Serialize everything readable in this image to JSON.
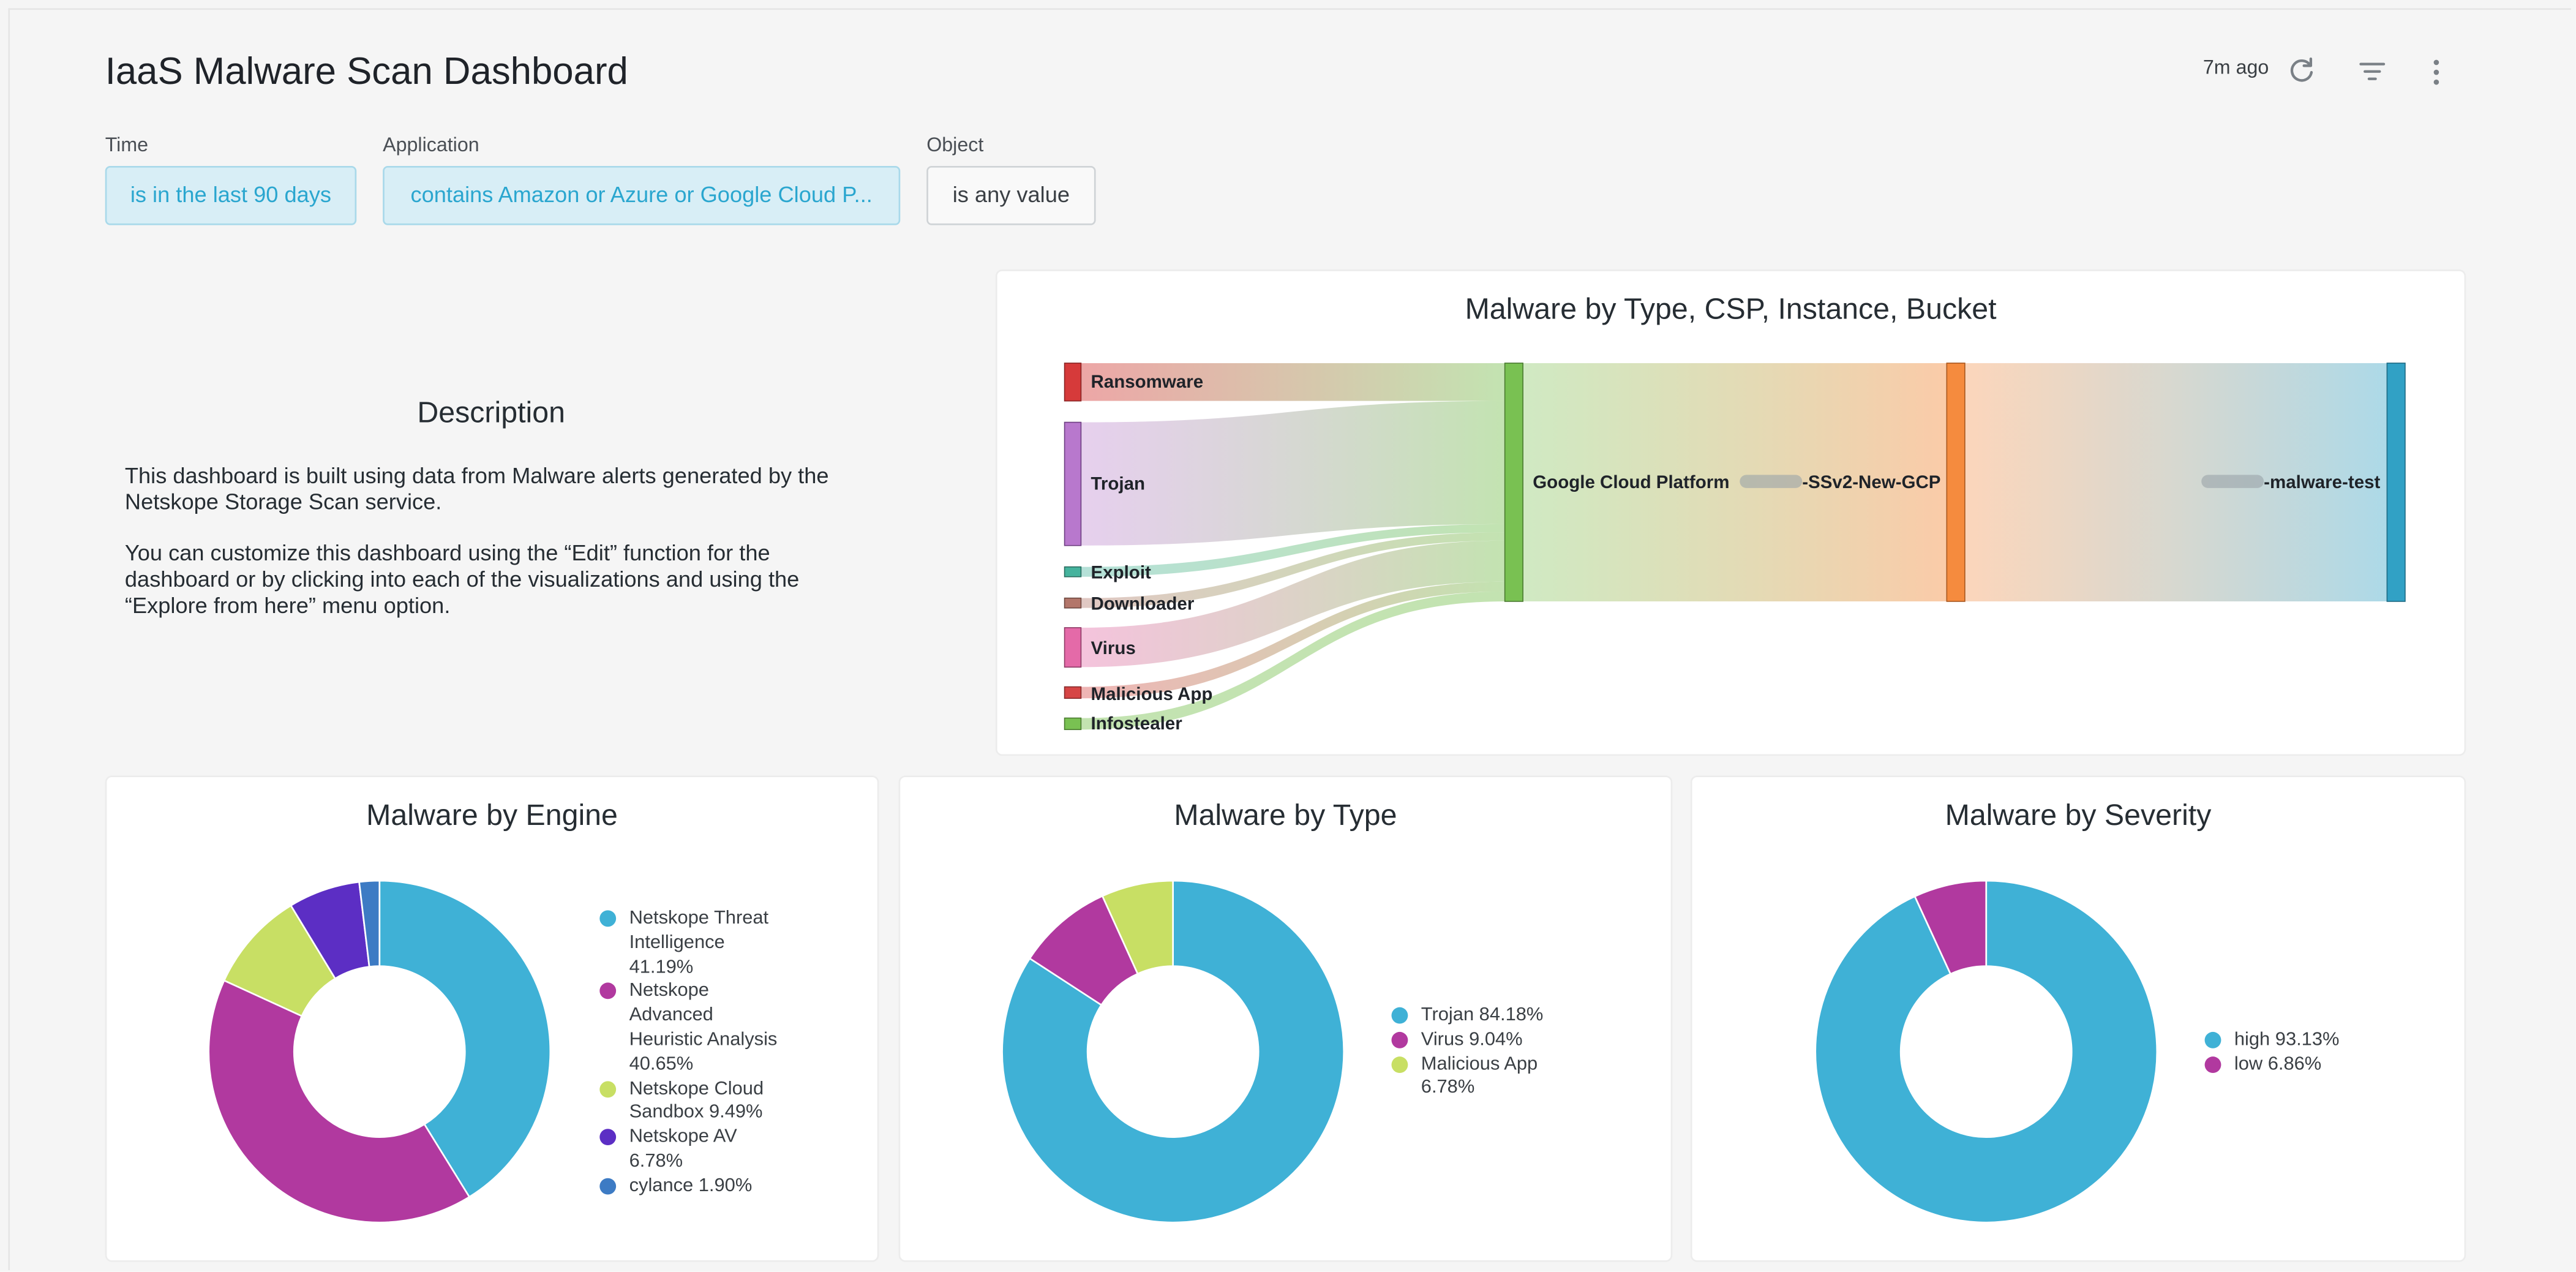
{
  "header": {
    "title": "IaaS Malware Scan Dashboard",
    "last_updated": "7m ago"
  },
  "filters": [
    {
      "label": "Time",
      "value": "is in the last 90 days"
    },
    {
      "label": "Application",
      "value": "contains Amazon or Azure or Google Cloud P..."
    },
    {
      "label": "Object",
      "value": "is any value"
    }
  ],
  "description": {
    "title": "Description",
    "paragraph1": "This dashboard is built using data from Malware alerts generated by the Netskope Storage Scan service.",
    "paragraph2": "You can customize this dashboard using the “Edit” function for the dashboard or by clicking into each of the visualizations and using the “Explore from here” menu option."
  },
  "colors": {
    "blue": "#3fb1d6",
    "magenta": "#b1399f",
    "lime": "#c8df64",
    "purple": "#5c2ec4",
    "steel": "#3d7bc4",
    "sankey_green": "#79c152",
    "sankey_orange": "#f58b3e",
    "sankey_teal": "#31a1c5"
  },
  "sankey": {
    "title": "Malware by Type, CSP, Instance, Bucket",
    "sources": [
      {
        "label": "Ransomware",
        "color": "#d63a3a"
      },
      {
        "label": "Trojan",
        "color": "#b878cd"
      },
      {
        "label": "Exploit",
        "color": "#45b39d"
      },
      {
        "label": "Downloader",
        "color": "#b3766a"
      },
      {
        "label": "Virus",
        "color": "#e46aa8"
      },
      {
        "label": "Malicious App",
        "color": "#d64545"
      },
      {
        "label": "Infostealer",
        "color": "#79c152"
      }
    ],
    "csp_label": "Google Cloud Platform",
    "instance_label": "-SSv2-New-GCP",
    "bucket_label": "-malware-test"
  },
  "charts": {
    "engine": {
      "title": "Malware by Engine",
      "legend": [
        {
          "lines": [
            "Netskope Threat",
            "Intelligence",
            "41.19%"
          ]
        },
        {
          "lines": [
            "Netskope",
            "Advanced",
            "Heuristic Analysis",
            "40.65%"
          ]
        },
        {
          "lines": [
            "Netskope Cloud",
            "Sandbox 9.49%"
          ]
        },
        {
          "lines": [
            "Netskope AV",
            "6.78%"
          ]
        },
        {
          "lines": [
            "cylance 1.90%"
          ]
        }
      ]
    },
    "type": {
      "title": "Malware by Type",
      "legend": [
        {
          "lines": [
            "Trojan 84.18%"
          ]
        },
        {
          "lines": [
            "Virus 9.04%"
          ]
        },
        {
          "lines": [
            "Malicious App",
            "6.78%"
          ]
        }
      ]
    },
    "severity": {
      "title": "Malware by Severity",
      "legend": [
        {
          "lines": [
            "high 93.13%"
          ]
        },
        {
          "lines": [
            "low 6.86%"
          ]
        }
      ]
    }
  },
  "chart_data": [
    {
      "type": "pie",
      "title": "Malware by Engine",
      "labels": [
        "Netskope Threat Intelligence",
        "Netskope Advanced Heuristic Analysis",
        "Netskope Cloud Sandbox",
        "Netskope AV",
        "cylance"
      ],
      "values": [
        41.19,
        40.65,
        9.49,
        6.78,
        1.9
      ],
      "colors": [
        "#3fb1d6",
        "#b1399f",
        "#c8df64",
        "#5c2ec4",
        "#3d7bc4"
      ],
      "legend": "right"
    },
    {
      "type": "pie",
      "title": "Malware by Type",
      "labels": [
        "Trojan",
        "Virus",
        "Malicious App"
      ],
      "values": [
        84.18,
        9.04,
        6.78
      ],
      "colors": [
        "#3fb1d6",
        "#b1399f",
        "#c8df64"
      ],
      "legend": "right"
    },
    {
      "type": "pie",
      "title": "Malware by Severity",
      "labels": [
        "high",
        "low"
      ],
      "values": [
        93.13,
        6.86
      ],
      "colors": [
        "#3fb1d6",
        "#b1399f"
      ],
      "legend": "right"
    }
  ]
}
